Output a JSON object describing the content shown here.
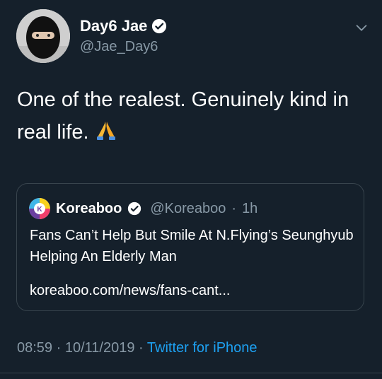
{
  "author": {
    "display_name": "Day6 Jae",
    "handle": "@Jae_Day6",
    "verified": true
  },
  "tweet": {
    "text": "One of the realest. Genuinely kind in real life.",
    "emoji": "folded-hands"
  },
  "quoted_tweet": {
    "display_name": "Koreaboo",
    "handle": "@Koreaboo",
    "separator": "·",
    "time_ago": "1h",
    "verified": true,
    "title": "Fans Can’t Help But Smile At N.Flying’s Seunghyub Helping An Elderly Man",
    "link_text": "koreaboo.com/news/fans-cant..."
  },
  "meta": {
    "time": "08:59",
    "sep1": "·",
    "date": "10/11/2019",
    "sep2": "·",
    "source": "Twitter for iPhone"
  },
  "colors": {
    "background": "#15202b",
    "secondary_text": "#8899a6",
    "link": "#1da1f2",
    "border": "#38444d"
  }
}
